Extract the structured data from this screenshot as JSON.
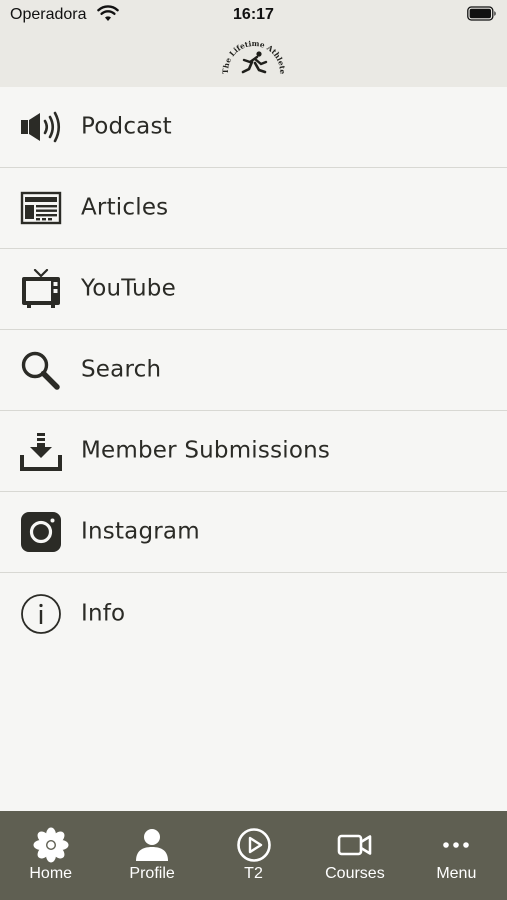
{
  "status_bar": {
    "carrier": "Operadora",
    "time": "16:17",
    "wifi_icon": "wifi-icon",
    "battery_icon": "battery-icon"
  },
  "header": {
    "logo_text": "The Lifetime Athlete"
  },
  "menu": {
    "items": [
      {
        "label": "Podcast",
        "icon": "speaker-icon"
      },
      {
        "label": "Articles",
        "icon": "newspaper-icon"
      },
      {
        "label": "YouTube",
        "icon": "tv-icon"
      },
      {
        "label": "Search",
        "icon": "magnifier-icon"
      },
      {
        "label": "Member Submissions",
        "icon": "download-icon"
      },
      {
        "label": "Instagram",
        "icon": "instagram-icon"
      },
      {
        "label": "Info",
        "icon": "info-icon"
      }
    ]
  },
  "tab_bar": {
    "tabs": [
      {
        "label": "Home",
        "icon": "flower-icon"
      },
      {
        "label": "Profile",
        "icon": "person-icon"
      },
      {
        "label": "T2",
        "icon": "play-circle-icon"
      },
      {
        "label": "Courses",
        "icon": "video-camera-icon"
      },
      {
        "label": "Menu",
        "icon": "more-dots-icon"
      }
    ]
  },
  "colors": {
    "background": "#f6f6f4",
    "header": "#eae9e4",
    "tab_bar": "#5f5f52",
    "icon": "#2b2b26",
    "divider": "#d8d8d3"
  }
}
